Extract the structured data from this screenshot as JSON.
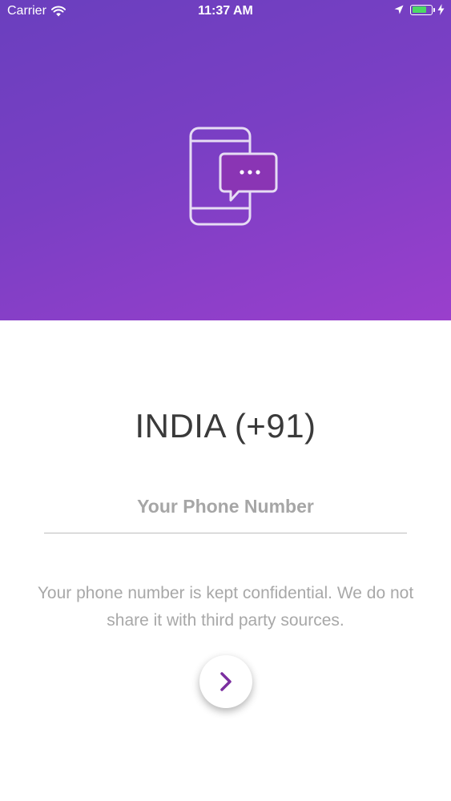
{
  "status_bar": {
    "carrier": "Carrier",
    "time": "11:37 AM",
    "battery_level": 0.8,
    "battery_color": "#4cd964"
  },
  "hero": {
    "gradient_start": "#6a3fbe",
    "gradient_end": "#9a3fcc",
    "icon": "phone-chat-icon"
  },
  "login": {
    "country": "INDIA (+91)",
    "phone_placeholder": "Your Phone Number",
    "phone_value": "",
    "notice": "Your phone number is kept confidential. We do not share it with third party sources.",
    "next_icon": "chevron-right-icon",
    "accent_color": "#7b2fa0"
  }
}
